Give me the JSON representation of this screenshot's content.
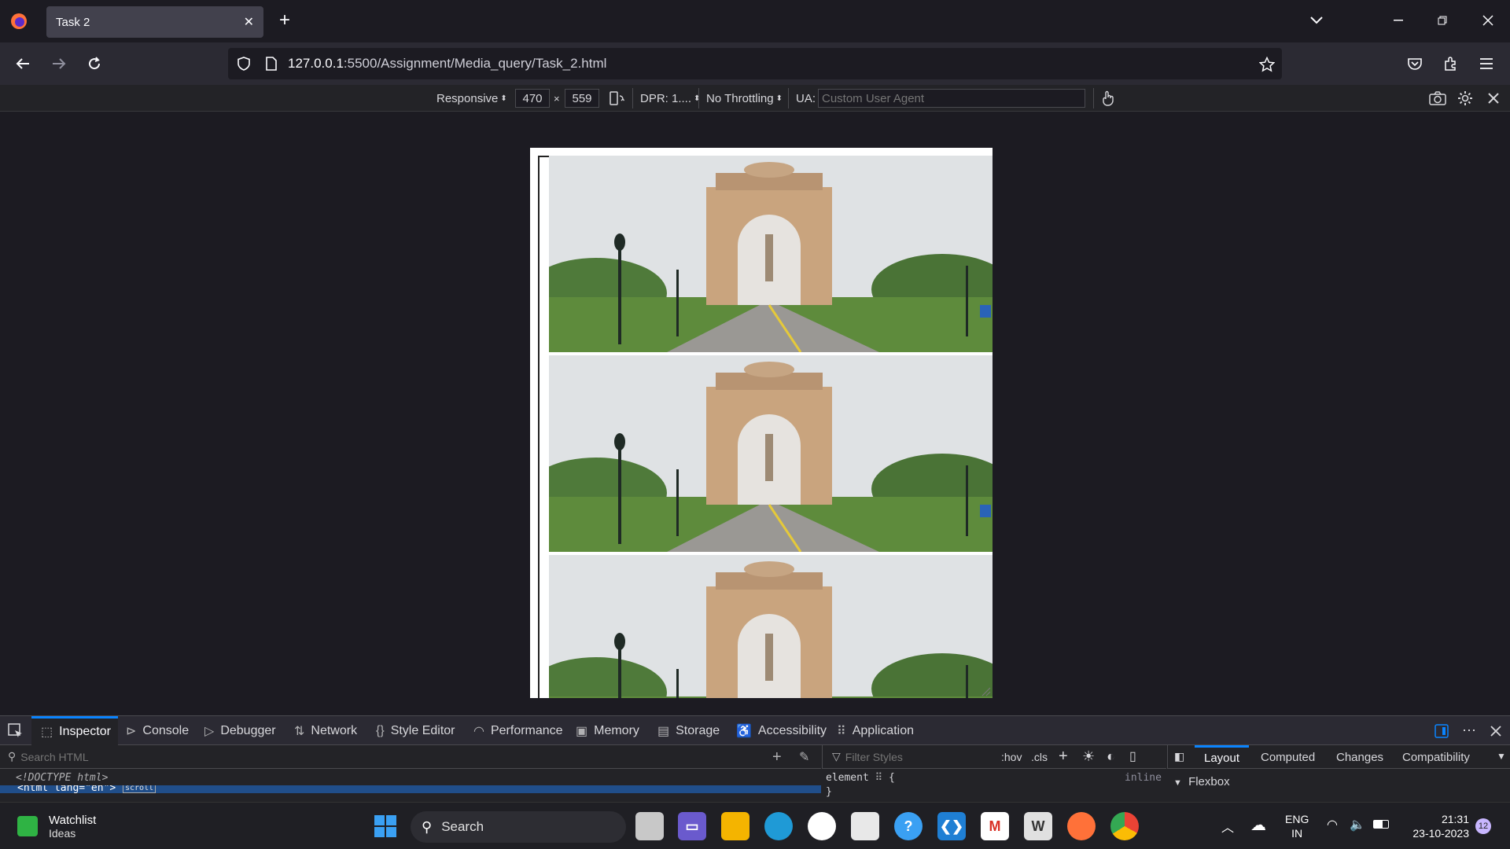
{
  "browser": {
    "tab_title": "Task 2",
    "tab_close": "✕",
    "new_tab": "+",
    "url_host": "127.0.0.1",
    "url_path": ":5500/Assignment/Media_query/Task_2.html"
  },
  "rdm": {
    "device": "Responsive",
    "width": "470",
    "times": "×",
    "height": "559",
    "dpr": "DPR: 1....",
    "throttling": "No Throttling",
    "ua_label": "UA:",
    "ua_placeholder": "Custom User Agent"
  },
  "devtools": {
    "tabs": [
      "Inspector",
      "Console",
      "Debugger",
      "Network",
      "Style Editor",
      "Performance",
      "Memory",
      "Storage",
      "Accessibility",
      "Application"
    ],
    "search_placeholder": "Search HTML",
    "filter_placeholder": "Filter Styles",
    "hov": ":hov",
    "cls": ".cls",
    "code_line1": "<!DOCTYPE html>",
    "code_line2": "<html lang=\"en\">",
    "scroll_badge": "scroll",
    "rule_selector": "element",
    "rule_open": "{",
    "rule_close": "}",
    "rule_origin": "inline",
    "side_tabs": [
      "Layout",
      "Computed",
      "Changes",
      "Compatibility"
    ],
    "flexbox": "Flexbox"
  },
  "taskbar": {
    "widget_title": "Watchlist",
    "widget_sub": "Ideas",
    "search": "Search",
    "lang1": "ENG",
    "lang2": "IN",
    "time": "21:31",
    "date": "23-10-2023",
    "badge": "12"
  },
  "colors": {
    "accent": "#0a84ff",
    "sky": "#d9dcdf",
    "arch": "#c9a47e",
    "grass": "#4a7a30"
  }
}
